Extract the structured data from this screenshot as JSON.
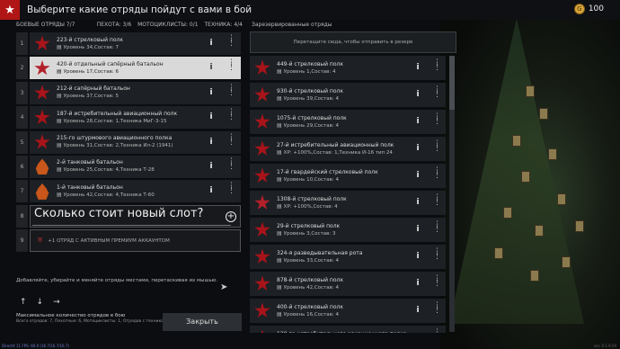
{
  "header": {
    "title": "Выберите какие отряды пойдут с вами в бой",
    "gold_amount": "100"
  },
  "left_header": {
    "title": "БОЕВЫЕ ОТРЯДЫ 7/7",
    "infantry": "ПЕХОТА: 3/6",
    "moto": "МОТОЦИКЛИСТЫ: 0/1",
    "tech": "ТЕХНИКА: 4/4"
  },
  "reserve_header": "Зарезервированные отряды",
  "slots": [
    {
      "num": "1",
      "name": "223-й стрелковый полк",
      "level": "Уровень 34",
      "comp": "Состав: 7",
      "extra": "",
      "emblem": "star"
    },
    {
      "num": "2",
      "name": "420-й отдельный сапёрный батальон",
      "level": "Уровень 17",
      "comp": "Состав: 6",
      "extra": "",
      "emblem": "gold"
    },
    {
      "num": "3",
      "name": "212-й сапёрный батальон",
      "level": "Уровень 37",
      "comp": "Состав: 5",
      "extra": "",
      "emblem": "star"
    },
    {
      "num": "4",
      "name": "187-й истребительный авиационный полк",
      "level": "Уровень 28",
      "comp": "Состав: 1",
      "extra": "Техника МиГ-3-15",
      "emblem": "star"
    },
    {
      "num": "5",
      "name": "215-го штурмового авиационного полка",
      "level": "Уровень 31",
      "comp": "Состав: 2",
      "extra": "Техника Ил-2 (1941)",
      "emblem": "star"
    },
    {
      "num": "6",
      "name": "2-й танковый батальон",
      "level": "Уровень 25",
      "comp": "Состав: 4",
      "extra": "Техника Т-28",
      "emblem": "fire"
    },
    {
      "num": "7",
      "name": "1-й танковый батальон",
      "level": "Уровень 42",
      "comp": "Состав: 4",
      "extra": "Техника Т-60",
      "emblem": "fire"
    }
  ],
  "empty_slot": {
    "num": "8",
    "question": "Сколько стоит новый слот?"
  },
  "locked_slot": {
    "num": "9",
    "text": "+1 ОТРЯД С АКТИВНЫМ ПРЕМИУМ АККАУНТОМ"
  },
  "hint": "Добавляйте, убирайте и меняйте отряды местами, перетаскивая их мышью.",
  "arrows": [
    "↑",
    "↓",
    "→"
  ],
  "max_info": {
    "title": "Максимальное количество отрядов в бою",
    "detail": "Всего отрядов: 7, Пехотные: 6, Мотоциклисты: 1, Отрядов с техникой: 4"
  },
  "close_label": "Закрыть",
  "drop_zone": "Перетащите сюда, чтобы отправить в резерв",
  "reserve": [
    {
      "name": "449-й стрелковый полк",
      "level": "Уровень 1",
      "comp": "Состав: 4",
      "extra": "",
      "emblem": "star"
    },
    {
      "name": "930-й стрелковый полк",
      "level": "Уровень 39",
      "comp": "Состав: 4",
      "extra": "",
      "emblem": "star"
    },
    {
      "name": "1075-й стрелковый полк",
      "level": "Уровень 29",
      "comp": "Состав: 4",
      "extra": "",
      "emblem": "star"
    },
    {
      "name": "27-й истребительный авиационный полк",
      "level": "XP: +100%",
      "comp": "Состав: 1",
      "extra": "Техника И-16 тип 24",
      "emblem": "star"
    },
    {
      "name": "17-й гвардейский стрелковый полк",
      "level": "Уровень 10",
      "comp": "Состав: 4",
      "extra": "",
      "emblem": "star"
    },
    {
      "name": "1308-й стрелковый полк",
      "level": "XP: +100%",
      "comp": "Состав: 4",
      "extra": "",
      "emblem": "gold"
    },
    {
      "name": "29-й стрелковый полк",
      "level": "Уровень 3",
      "comp": "Состав: 3",
      "extra": "",
      "emblem": "star"
    },
    {
      "name": "324-я разведывательная рота",
      "level": "Уровень 33",
      "comp": "Состав: 4",
      "extra": "",
      "emblem": "star"
    },
    {
      "name": "878-й стрелковый полк",
      "level": "Уровень 42",
      "comp": "Состав: 4",
      "extra": "",
      "emblem": "star"
    },
    {
      "name": "400-й стрелковый полк",
      "level": "Уровень 16",
      "comp": "Состав: 4",
      "extra": "",
      "emblem": "star"
    },
    {
      "name": "120-го истребительного авиационного полка",
      "level": "Уровень 15",
      "comp": "Состав: 1",
      "extra": "Техника И-153 М-62",
      "emblem": "star"
    }
  ],
  "reserve_first_prefix": "XP: +100%",
  "statusbar": "DirectX 11 FPS: 60.0 (16.7/16.7/16.7)",
  "version": "ver. 0.1.9.59"
}
